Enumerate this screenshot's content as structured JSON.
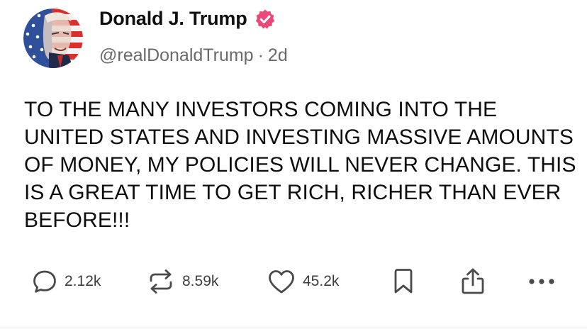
{
  "author": {
    "name": "Donald J. Trump",
    "handle": "@realDonaldTrump",
    "separator": "·",
    "age": "2d",
    "verified_color": "#e94a7a"
  },
  "post": {
    "text": "TO THE MANY INVESTORS COMING INTO THE UNITED STATES AND INVESTING MASSIVE AMOUNTS OF MONEY, MY POLICIES WILL NEVER CHANGE. THIS IS A GREAT TIME TO GET RICH, RICHER THAN EVER BEFORE!!!"
  },
  "actions": {
    "reply": {
      "icon": "reply-icon",
      "count": "2.12k"
    },
    "repost": {
      "icon": "repost-icon",
      "count": "8.59k"
    },
    "like": {
      "icon": "heart-icon",
      "count": "45.2k"
    },
    "bookmark": {
      "icon": "bookmark-icon"
    },
    "share": {
      "icon": "share-icon"
    },
    "more": {
      "icon": "more-icon"
    }
  },
  "colors": {
    "icon_stroke": "#4a4a4a",
    "handle_text": "#6a6a6a",
    "body_text": "#0e0e0e"
  }
}
